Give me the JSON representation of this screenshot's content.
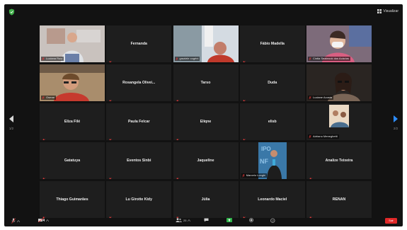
{
  "header": {
    "view_label": "Visualizar"
  },
  "pages": {
    "left": "1/2",
    "right": "2/2"
  },
  "colors": {
    "background": "#121212",
    "tile": "#1e1e1e",
    "active_speaker": "#b9d63b",
    "muted_mic": "#e23b3b",
    "end": "#e02828"
  },
  "participants": [
    {
      "name": "Luciana Ruiz",
      "has_video": true
    },
    {
      "name": "Fernanda",
      "has_video": false
    },
    {
      "name": "graziele cogrini",
      "has_video": true
    },
    {
      "name": "Fábio Madella",
      "has_video": false
    },
    {
      "name": "Cintia Seabrook dos Acácios",
      "has_video": true
    },
    {
      "name": "Osmar",
      "has_video": true,
      "speaking": true
    },
    {
      "name": "Rosangela Olivei...",
      "has_video": false
    },
    {
      "name": "Tarso",
      "has_video": false
    },
    {
      "name": "Duda",
      "has_video": false
    },
    {
      "name": "Luciane Acosta",
      "has_video": true
    },
    {
      "name": "Eliza Filé",
      "has_video": false
    },
    {
      "name": "Paula Felcar",
      "has_video": false
    },
    {
      "name": "Eliqne",
      "has_video": false
    },
    {
      "name": "elisb",
      "has_video": false
    },
    {
      "name": "Adriano Meneghetti",
      "has_video": true
    },
    {
      "name": "Gatatuya",
      "has_video": false
    },
    {
      "name": "Eventos Sinbi",
      "has_video": false
    },
    {
      "name": "Jaqueline",
      "has_video": false
    },
    {
      "name": "Marcelo Longhi",
      "has_video": true
    },
    {
      "name": "Analize Teixeira",
      "has_video": false
    },
    {
      "name": "Thiago Guimarães",
      "has_video": false
    },
    {
      "name": "Lu Girotte Kidy",
      "has_video": false
    },
    {
      "name": "Júlia",
      "has_video": false
    },
    {
      "name": "Leonardo Maciel",
      "has_video": false
    },
    {
      "name": "RENAN",
      "has_video": false
    }
  ],
  "toolbar": {
    "participants_count": "25",
    "end_label": "Sair"
  }
}
